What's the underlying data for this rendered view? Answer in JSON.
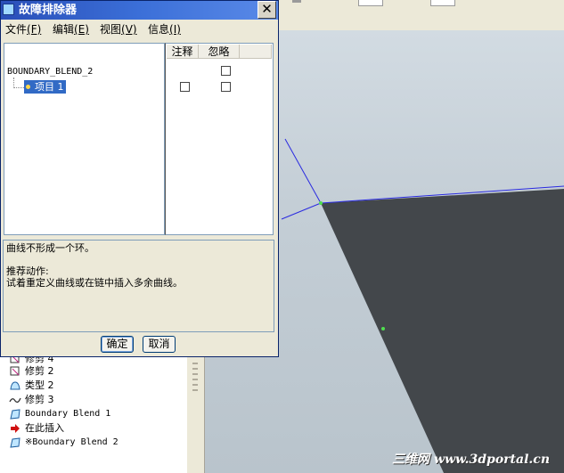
{
  "dialog": {
    "title": "故障排除器",
    "close_glyph": "✕",
    "menu": [
      {
        "label": "文件",
        "key": "(F)"
      },
      {
        "label": "编辑",
        "key": "(E)"
      },
      {
        "label": "视图",
        "key": "(V)"
      },
      {
        "label": "信息",
        "key": "(I)"
      }
    ],
    "columns": [
      "注释",
      "忽略"
    ],
    "tree": {
      "root": "BOUNDARY_BLEND_2",
      "child": "项目 1"
    },
    "message": {
      "line1": "曲线不形成一个环。",
      "line2": "推荐动作:",
      "line3": "试着重定义曲线或在链中插入多余曲线。"
    },
    "ok_label": "确定",
    "cancel_label": "取消"
  },
  "model_tree": {
    "items": [
      {
        "label": "修剪 4",
        "icon": "trim-icon",
        "mono": false
      },
      {
        "label": "修剪 2",
        "icon": "trim-icon",
        "mono": false
      },
      {
        "label": "类型 2",
        "icon": "surface-type-icon",
        "mono": false
      },
      {
        "label": "修剪 3",
        "icon": "curve-trim-icon",
        "mono": false
      },
      {
        "label": "Boundary Blend 1",
        "icon": "boundary-blend-icon",
        "mono": true
      },
      {
        "label": "在此插入",
        "icon": "insert-arrow-icon",
        "mono": false
      },
      {
        "label": "※Boundary Blend 2",
        "icon": "boundary-blend-icon",
        "mono": true
      }
    ]
  },
  "watermark": "三维网 www.3dportal.cn",
  "colors": {
    "title_bar": "#3b6fd8",
    "selection": "#316ac5",
    "surface": "#43474b",
    "datum_line": "#2020e0"
  }
}
